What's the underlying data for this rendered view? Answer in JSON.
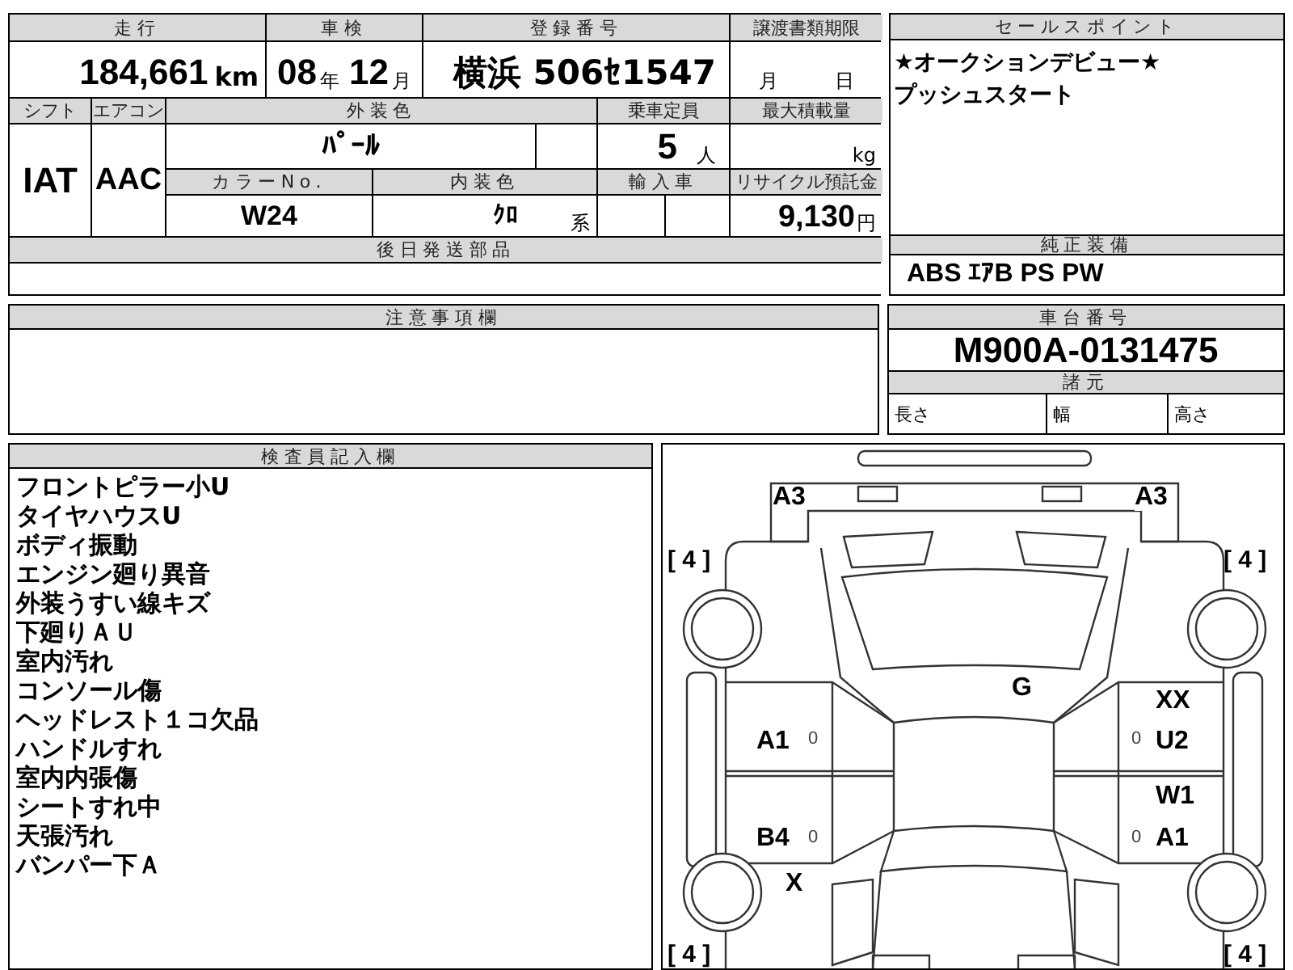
{
  "vehicle_table": {
    "mileage": {
      "label": "走行",
      "value": "184,661",
      "unit": "km"
    },
    "inspection": {
      "label": "車検",
      "year": "08",
      "year_unit": "年",
      "month": "12",
      "month_unit": "月"
    },
    "registration": {
      "label": "登録番号",
      "value": "横浜 506ｾ1547"
    },
    "transfer_deadline": {
      "label": "譲渡書類期限",
      "month_unit": "月",
      "day_unit": "日"
    },
    "shift": {
      "label": "シフト",
      "value": "IAT"
    },
    "aircon": {
      "label": "エアコン",
      "value": "AAC"
    },
    "exterior_color": {
      "label": "外装色",
      "value": "ﾊﾟｰﾙ"
    },
    "capacity": {
      "label": "乗車定員",
      "value": "5",
      "unit": "人"
    },
    "max_load": {
      "label": "最大積載量",
      "unit": "kg"
    },
    "color_no": {
      "label": "カラーNo.",
      "value": "W24"
    },
    "interior_color": {
      "label": "内装色",
      "value": "ｸﾛ",
      "unit": "系"
    },
    "imported": {
      "label": "輸入車"
    },
    "recycle_fee": {
      "label": "リサイクル預託金",
      "value": "9,130",
      "unit": "円"
    },
    "later_parts": {
      "label": "後日発送部品"
    }
  },
  "sales_points": {
    "label": "セールスポイント",
    "lines": [
      "★オークションデビュー★",
      "プッシュスタート"
    ]
  },
  "standard_equipment": {
    "label": "純正装備",
    "value": "ABS ｴｱB PS PW"
  },
  "notes": {
    "label": "注意事項欄"
  },
  "chassis": {
    "label": "車台番号",
    "value": "M900A-0131475",
    "spec_label": "諸元",
    "specs": [
      "長さ",
      "幅",
      "高さ"
    ]
  },
  "inspector_notes": {
    "label": "検査員記入欄",
    "lines": [
      "フロントピラー小U",
      "タイヤハウスU",
      "ボディ振動",
      "エンジン廻り異音",
      "外装うすい線キズ",
      "下廻りＡＵ",
      "室内汚れ",
      "コンソール傷",
      "ヘッドレスト１コ欠品",
      "ハンドルすれ",
      "室内内張傷",
      "シートすれ中",
      "天張汚れ",
      "バンパー下Ａ"
    ]
  },
  "diagram": {
    "damage_labels": [
      "A3",
      "A3",
      "G",
      "A1",
      "XX",
      "U2",
      "B4",
      "W1",
      "A1",
      "X"
    ],
    "tire_labels": [
      "[ 4 ]",
      "[ 4 ]",
      "[ 4 ]",
      "[ 4 ]"
    ],
    "panel_marks": [
      "0",
      "0",
      "0",
      "0"
    ]
  }
}
